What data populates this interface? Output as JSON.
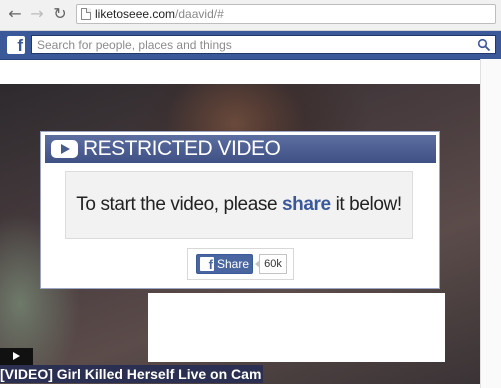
{
  "browser": {
    "url_domain": "liketoseee.com",
    "url_path": "/daavid/#",
    "back_icon": "arrow-left-icon",
    "forward_icon": "arrow-right-icon",
    "reload_icon": "reload-icon"
  },
  "facebook": {
    "logo_letter": "f",
    "search_placeholder": "Search for people, places and things",
    "brand_color": "#3b5998"
  },
  "overlay": {
    "title": "RESTRICTED VIDEO",
    "message_before": "To start the video, please ",
    "message_highlight": "share",
    "message_after": " it below!",
    "share_logo_letter": "f",
    "share_label": "Share",
    "share_count": "60k"
  },
  "video": {
    "caption": "[VIDEO] Girl Killed Herself Live on Cam"
  }
}
